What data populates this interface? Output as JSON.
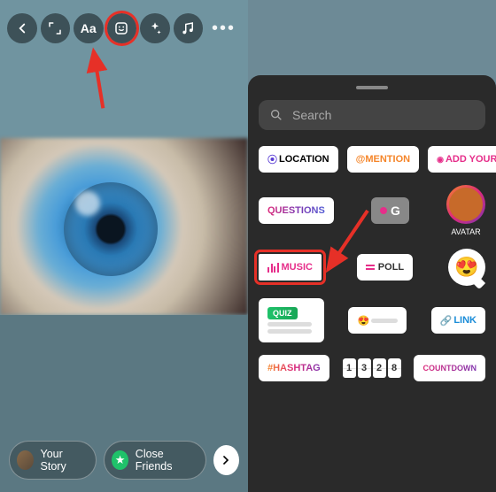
{
  "left": {
    "toolbar": {
      "back": "‹",
      "resize": "resize-icon",
      "text": "Aa",
      "sticker": "sticker-icon",
      "effects": "effects-icon",
      "music": "music-icon",
      "more": "more-icon"
    },
    "share": {
      "your_story": "Your Story",
      "close_friends": "Close Friends",
      "next": "›"
    }
  },
  "right": {
    "search_placeholder": "Search",
    "stickers": {
      "location": "LOCATION",
      "mention": "@MENTION",
      "add_yours": "ADD YOURS",
      "questions": "QUESTIONS",
      "gif": "G",
      "avatar": "AVATAR",
      "music": "MUSIC",
      "poll": "POLL",
      "quiz": "QUIZ",
      "link": "LINK",
      "hashtag": "#HASHTAG",
      "countdown_digits": [
        "1",
        "3",
        "2",
        "8"
      ],
      "countdown": "COUNTDOWN"
    },
    "emojis": {
      "hearteyes": "😍",
      "slider": "😍"
    }
  },
  "annotations": {
    "highlight_sticker_button": true,
    "highlight_music_sticker": true
  }
}
